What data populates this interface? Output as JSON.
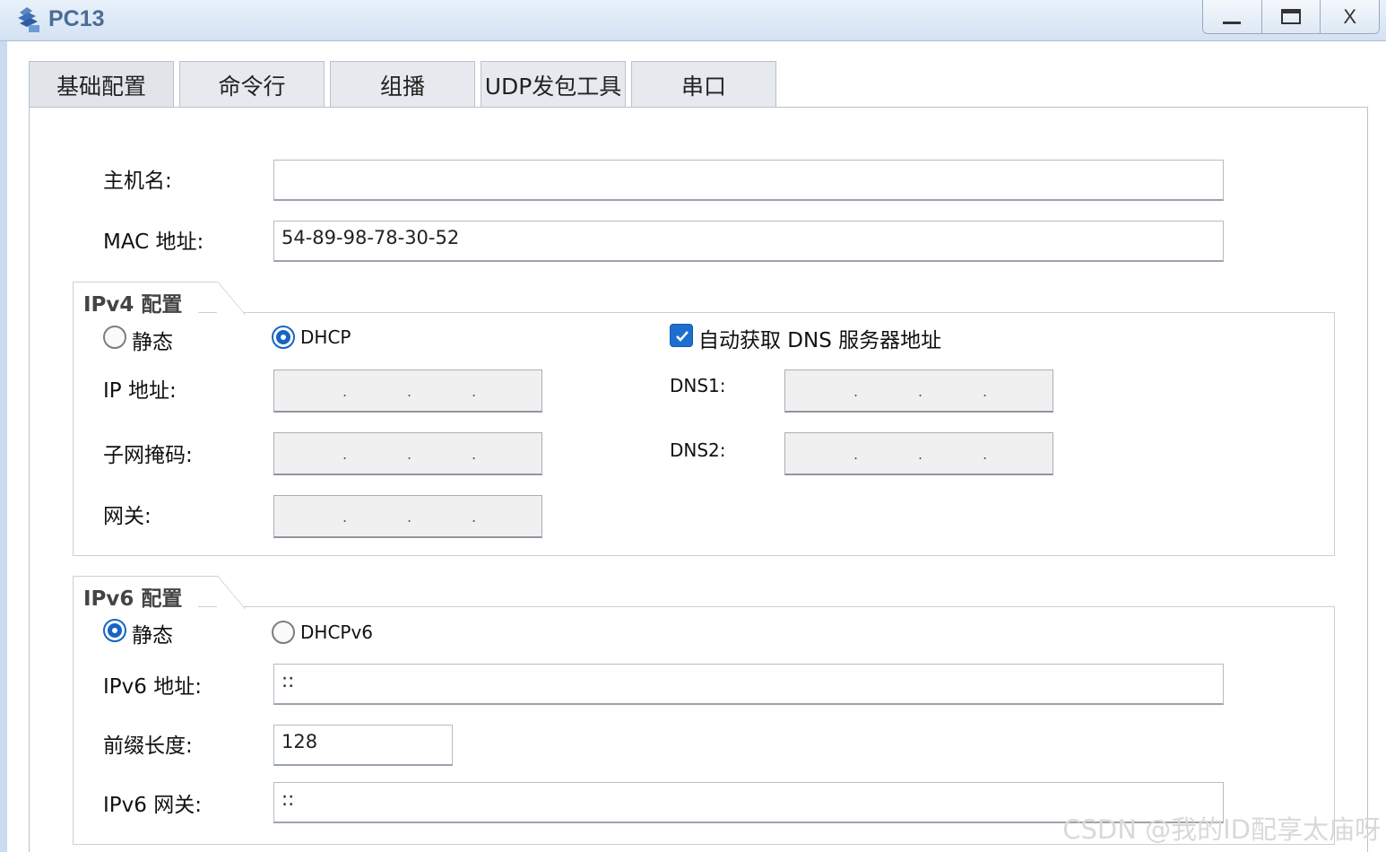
{
  "window": {
    "title": "PC13",
    "minimize_label": "_",
    "maximize_label": "□",
    "close_label": "X"
  },
  "tabs": [
    {
      "label": "基础配置",
      "active": true
    },
    {
      "label": "命令行"
    },
    {
      "label": "组播"
    },
    {
      "label": "UDP发包工具"
    },
    {
      "label": "串口"
    }
  ],
  "basic": {
    "hostname_label": "主机名:",
    "hostname_value": "",
    "mac_label": "MAC 地址:",
    "mac_value": "54-89-98-78-30-52"
  },
  "ipv4": {
    "group_title": "IPv4 配置",
    "static_label": "静态",
    "dhcp_label": "DHCP",
    "selected_mode": "DHCP",
    "auto_dns_label": "自动获取 DNS 服务器地址",
    "auto_dns_checked": true,
    "ip_label": "IP 地址:",
    "mask_label": "子网掩码:",
    "gateway_label": "网关:",
    "dns1_label": "DNS1:",
    "dns2_label": "DNS2:",
    "dot": "."
  },
  "ipv6": {
    "group_title": "IPv6 配置",
    "static_label": "静态",
    "dhcp_label": "DHCPv6",
    "selected_mode": "静态",
    "address_label": "IPv6 地址:",
    "address_value": "::",
    "prefix_label": "前缀长度:",
    "prefix_value": "128",
    "gateway_label": "IPv6 网关:",
    "gateway_value": "::"
  },
  "watermark": "CSDN @我的ID配享太庙呀",
  "colors": {
    "accent": "#1664c5",
    "title_text": "#4a6c95"
  }
}
